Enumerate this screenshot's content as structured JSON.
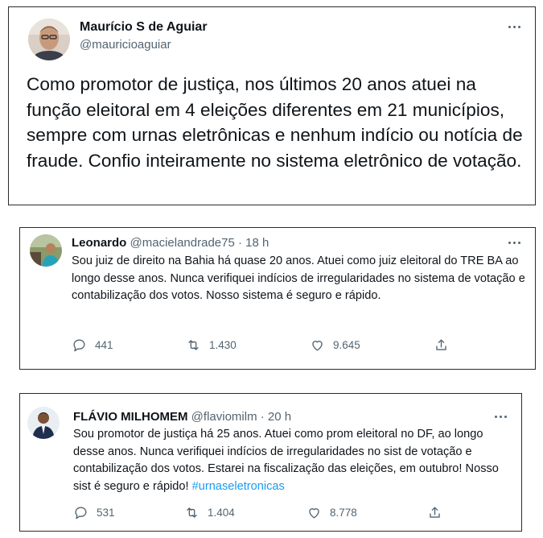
{
  "tweet1": {
    "name": "Maurício S de Aguiar",
    "handle": "@mauricioaguiar",
    "text": "Como promotor de justiça, nos últimos 20 anos atuei na função eleitoral em 4 eleições diferentes em 21 municípios, sempre com urnas eletrônicas e nenhum indício ou notícia de fraude. Confio inteiramente no sistema eletrônico de votação."
  },
  "tweet2": {
    "name": "Leonardo",
    "handle": "@macielandrade75",
    "dot": "·",
    "time": "18 h",
    "text": "Sou juiz de direito na Bahia há quase 20 anos. Atuei como juiz eleitoral do TRE BA  ao longo desse anos. Nunca verifiquei indícios de irregularidades no sistema de votação e contabilização dos votos. Nosso sistema é seguro e rápido.",
    "replies": "441",
    "retweets": "1.430",
    "likes": "9.645"
  },
  "tweet3": {
    "name": "FLÁVIO MILHOMEM",
    "handle": "@flaviomilm",
    "dot": "·",
    "time": "20 h",
    "text": "Sou promotor de justiça há 25 anos. Atuei como prom eleitoral no DF, ao longo desse anos. Nunca verifiquei indícios de irregularidades no sist de votação e contabilização dos votos. Estarei na fiscalização das eleições, em outubro! Nosso sist é seguro e rápido! ",
    "hashtag": "#urnaseletronicas",
    "replies": "531",
    "retweets": "1.404",
    "likes": "8.778"
  },
  "icons": {
    "more": "more-horizontal-icon",
    "reply": "reply-icon",
    "retweet": "retweet-icon",
    "like": "heart-icon",
    "share": "share-icon"
  },
  "colors": {
    "text": "#0f1419",
    "secondary": "#536471",
    "link": "#1d9bf0"
  }
}
